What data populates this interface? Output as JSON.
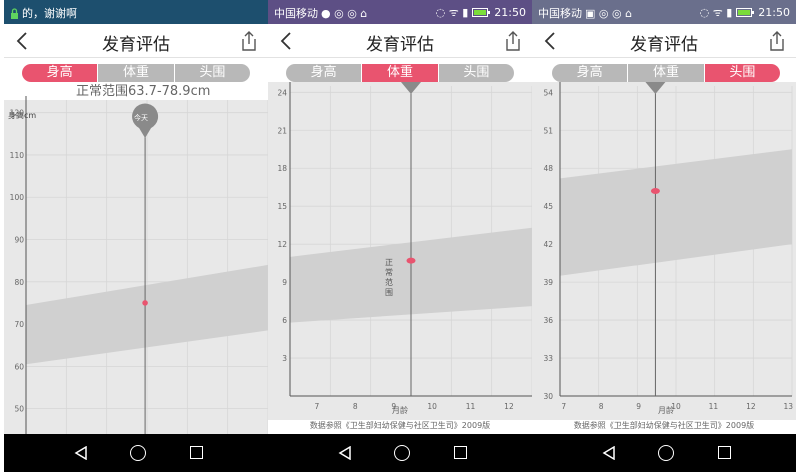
{
  "app": {
    "title": "发育评估",
    "tabs": [
      "身高",
      "体重",
      "头围"
    ],
    "source_note": "数据参照《卫生部妇幼保健与社区卫生司》2009版",
    "x_axis_label": "月龄",
    "normal_range_label": "正常范围",
    "today_label": "今天"
  },
  "status_bars": [
    {
      "left_text": "的，谢谢啊",
      "time": "",
      "bg": "#1d4f6e"
    },
    {
      "left_text": "中国移动",
      "time": "21:50",
      "bg": "#5d4f85"
    },
    {
      "left_text": "中国移动",
      "time": "21:50",
      "bg": "#6a6f8c"
    }
  ],
  "height_panel": {
    "range_text": "正常范围63.7-78.9cm",
    "y_axis_label": "身高cm"
  },
  "colors": {
    "accent": "#e9546f",
    "tab_inactive": "#b8b8b8",
    "band": "#d0d0d0",
    "plot_bg": "#e8e8e8"
  },
  "chart_data": [
    {
      "type": "area",
      "title": "身高",
      "ylabel": "身高cm",
      "ylim": [
        44,
        123
      ],
      "xlim": [
        6.3,
        12.6
      ],
      "y_ticks": [
        50,
        60,
        70,
        80,
        90,
        100,
        110,
        120
      ],
      "x_ticks": [],
      "band": {
        "x": [
          6.3,
          12.6
        ],
        "lower": [
          60.5,
          68.5
        ],
        "upper": [
          74.5,
          84.0
        ]
      },
      "point": {
        "x": 9.4,
        "y": 75.0
      },
      "today_x": 9.4
    },
    {
      "type": "area",
      "title": "体重",
      "xlabel": "月龄",
      "ylim": [
        0,
        24.5
      ],
      "xlim": [
        6.3,
        12.6
      ],
      "y_ticks": [
        3,
        6,
        9,
        12,
        15,
        18,
        21,
        24
      ],
      "x_ticks": [
        7,
        8,
        9,
        10,
        11,
        12
      ],
      "band": {
        "x": [
          6.3,
          12.6
        ],
        "lower": [
          5.8,
          7.1
        ],
        "upper": [
          11.0,
          13.3
        ]
      },
      "point": {
        "x": 9.45,
        "y": 10.7
      },
      "today_x": 9.45
    },
    {
      "type": "area",
      "title": "头围",
      "xlabel": "月龄",
      "ylim": [
        30,
        54.5
      ],
      "xlim": [
        6.9,
        13.1
      ],
      "y_ticks": [
        30,
        33,
        36,
        39,
        42,
        45,
        48,
        51,
        54
      ],
      "x_ticks": [
        7,
        8,
        9,
        10,
        11,
        12,
        13
      ],
      "band": {
        "x": [
          6.9,
          13.1
        ],
        "lower": [
          39.5,
          42.0
        ],
        "upper": [
          47.2,
          49.5
        ]
      },
      "point": {
        "x": 9.45,
        "y": 46.2
      },
      "today_x": 9.45
    }
  ]
}
